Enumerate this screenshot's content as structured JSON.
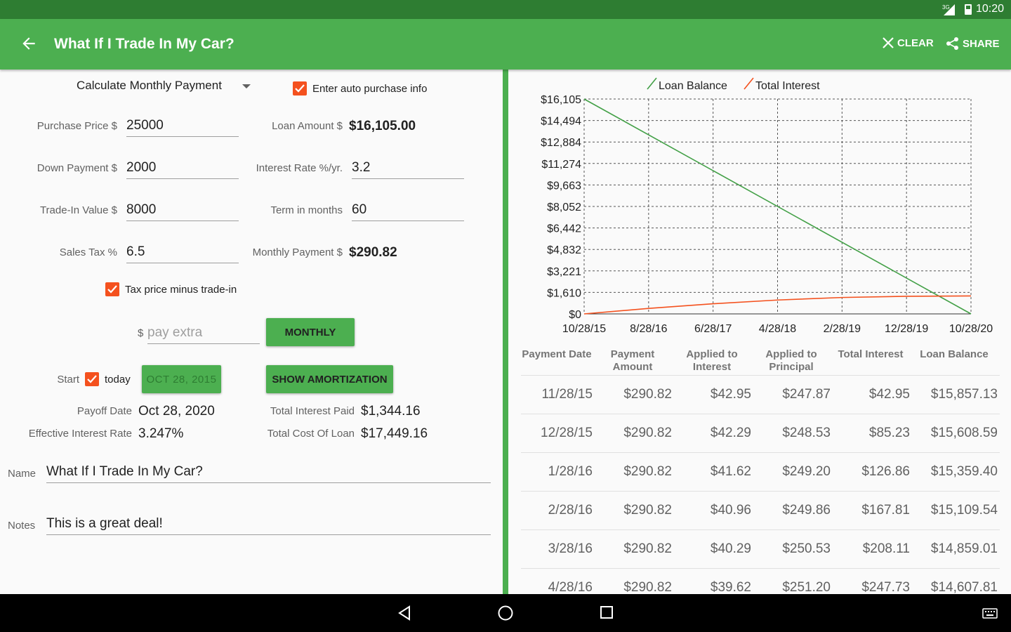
{
  "status_bar": {
    "time": "10:20",
    "network": "3G"
  },
  "toolbar": {
    "title": "What If I Trade In My Car?",
    "clear_label": "CLEAR",
    "share_label": "SHARE",
    "color": "#4caf50"
  },
  "form": {
    "mode_select": "Calculate Monthly Payment",
    "auto_purchase_label": "Enter auto purchase info",
    "purchase_price_label": "Purchase Price $",
    "purchase_price": "25000",
    "loan_amount_label": "Loan Amount $",
    "loan_amount": "$16,105.00",
    "down_payment_label": "Down Payment $",
    "down_payment": "2000",
    "interest_rate_label": "Interest Rate %/yr.",
    "interest_rate": "3.2",
    "trade_in_label": "Trade-In Value $",
    "trade_in": "8000",
    "term_label": "Term in months",
    "term": "60",
    "sales_tax_label": "Sales Tax %",
    "sales_tax": "6.5",
    "monthly_payment_label": "Monthly Payment $",
    "monthly_payment": "$290.82",
    "tax_minus_tradein_label": "Tax price minus trade-in",
    "pay_extra_prefix": "$",
    "pay_extra_placeholder": "pay extra",
    "monthly_button": "MONTHLY",
    "start_label": "Start",
    "today_label": "today",
    "start_date_button": "OCT 28, 2015",
    "show_amortization_button": "SHOW AMORTIZATION",
    "payoff_date_label": "Payoff Date",
    "payoff_date": "Oct 28, 2020",
    "total_interest_label": "Total Interest Paid",
    "total_interest": "$1,344.16",
    "effective_rate_label": "Effective Interest Rate",
    "effective_rate": "3.247%",
    "total_cost_label": "Total Cost Of Loan",
    "total_cost": "$17,449.16",
    "name_label": "Name",
    "name_value": "What If I Trade In My Car?",
    "notes_label": "Notes",
    "notes_value": "This is a great deal!"
  },
  "chart_data": {
    "type": "line",
    "x": [
      "10/28/15",
      "8/28/16",
      "6/28/17",
      "4/28/18",
      "2/28/19",
      "12/28/19",
      "10/28/20"
    ],
    "y_ticks": [
      "$16,105",
      "$14,494",
      "$12,884",
      "$11,274",
      "$9,663",
      "$8,052",
      "$6,442",
      "$4,832",
      "$3,221",
      "$1,610",
      "$0"
    ],
    "ylim": [
      0,
      16105
    ],
    "grid": true,
    "legend_position": "top",
    "series": [
      {
        "name": "Loan Balance",
        "color": "#43a047",
        "x_index": [
          0,
          6
        ],
        "values": [
          16105,
          0
        ]
      },
      {
        "name": "Total Interest",
        "color": "#f4511e",
        "x_index": [
          0,
          1,
          2,
          3,
          4,
          5,
          6
        ],
        "values": [
          0,
          410,
          760,
          1040,
          1230,
          1320,
          1344.16
        ]
      }
    ]
  },
  "table": {
    "headers": [
      [
        "Payment Date"
      ],
      [
        "Payment",
        "Amount"
      ],
      [
        "Applied to",
        "Interest"
      ],
      [
        "Applied to",
        "Principal"
      ],
      [
        "Total Interest"
      ],
      [
        "Loan Balance"
      ]
    ],
    "rows": [
      [
        "11/28/15",
        "$290.82",
        "$42.95",
        "$247.87",
        "$42.95",
        "$15,857.13"
      ],
      [
        "12/28/15",
        "$290.82",
        "$42.29",
        "$248.53",
        "$85.23",
        "$15,608.59"
      ],
      [
        "1/28/16",
        "$290.82",
        "$41.62",
        "$249.20",
        "$126.86",
        "$15,359.40"
      ],
      [
        "2/28/16",
        "$290.82",
        "$40.96",
        "$249.86",
        "$167.81",
        "$15,109.54"
      ],
      [
        "3/28/16",
        "$290.82",
        "$40.29",
        "$250.53",
        "$208.11",
        "$14,859.01"
      ],
      [
        "4/28/16",
        "$290.82",
        "$39.62",
        "$251.20",
        "$247.73",
        "$14,607.81"
      ]
    ]
  }
}
